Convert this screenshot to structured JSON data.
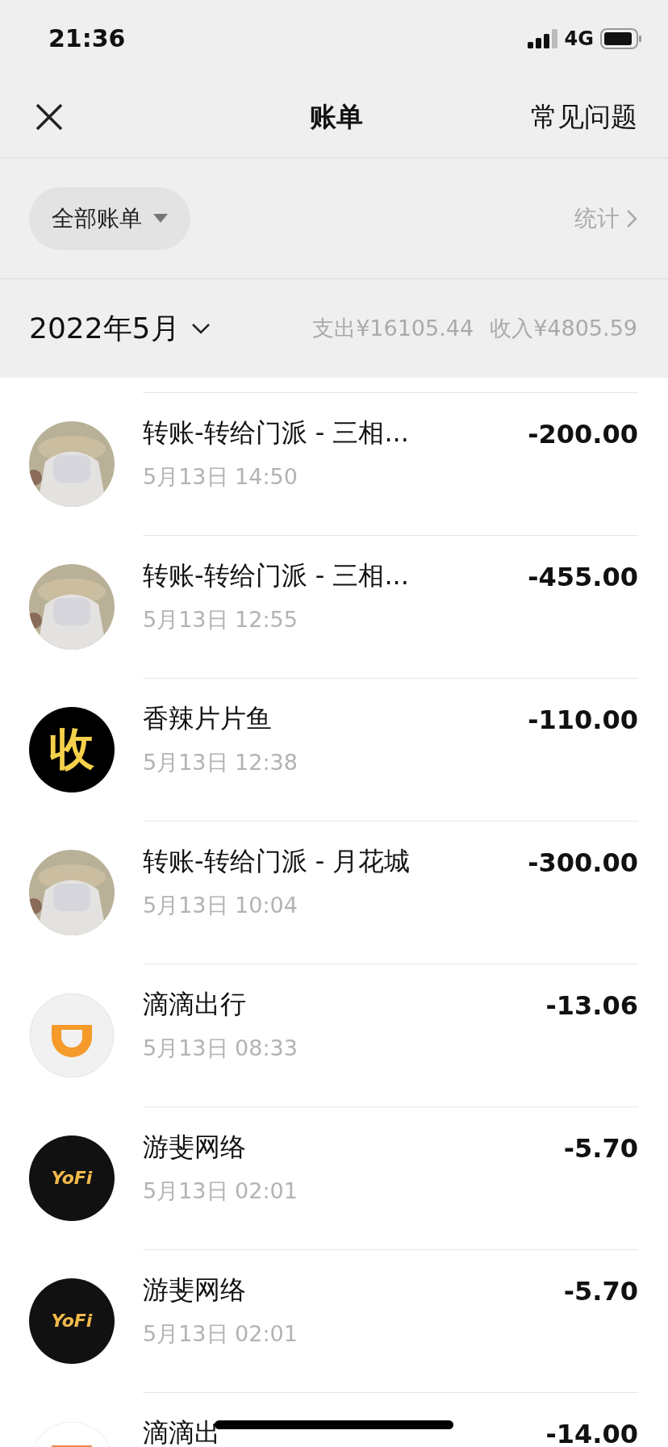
{
  "status_bar": {
    "time": "21:36",
    "network": "4G"
  },
  "nav": {
    "title": "账单",
    "action": "常见问题"
  },
  "filter": {
    "label": "全部账单",
    "stats": "统计"
  },
  "month": {
    "label": "2022年5月",
    "expense": "支出¥16105.44",
    "income": "收入¥4805.59"
  },
  "transactions": [
    {
      "title": "转账-转给门派 - 三相...",
      "time": "5月13日 14:50",
      "amount": "-200.00"
    },
    {
      "title": "转账-转给门派 - 三相...",
      "time": "5月13日 12:55",
      "amount": "-455.00"
    },
    {
      "avatar": {
        "kind": "text",
        "text": "收"
      },
      "title": "香辣片片鱼",
      "time": "5月13日 12:38",
      "amount": "-110.00"
    },
    {
      "title": "转账-转给门派 - 月花城",
      "time": "5月13日 10:04",
      "amount": "-300.00"
    },
    {
      "avatar": {
        "kind": "didi"
      },
      "title": "滴滴出行",
      "time": "5月13日 08:33",
      "amount": "-13.06"
    },
    {
      "avatar": {
        "kind": "yofi",
        "text": "YoFi"
      },
      "title": "游斐网络",
      "time": "5月13日 02:01",
      "amount": "-5.70"
    },
    {
      "avatar": {
        "kind": "yofi",
        "text": "YoFi"
      },
      "title": "游斐网络",
      "time": "5月13日 02:01",
      "amount": "-5.70"
    },
    {
      "avatar": {
        "kind": "didi_square"
      },
      "title": "滴滴出",
      "amount": "-14.00"
    }
  ]
}
